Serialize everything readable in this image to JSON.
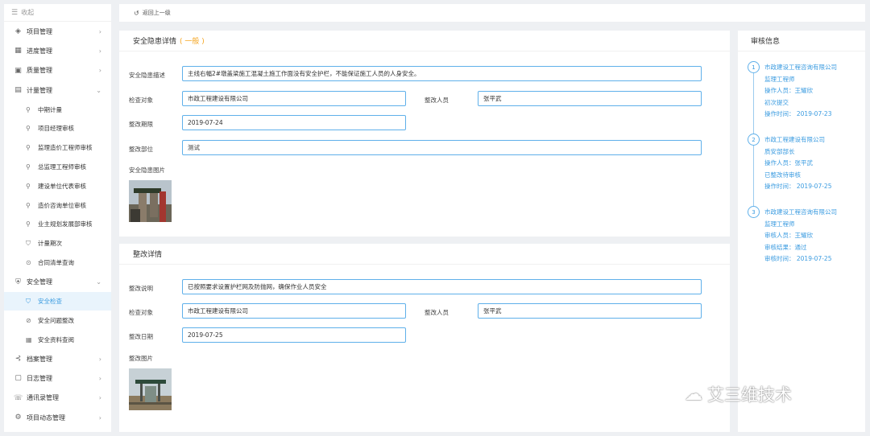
{
  "sidebar": {
    "collapse_label": "收起",
    "items": [
      {
        "label": "项目管理",
        "icon": "layers-icon",
        "glyph": "◈",
        "chevron": "›"
      },
      {
        "label": "进度管理",
        "icon": "grid-icon",
        "glyph": "▦",
        "chevron": "›"
      },
      {
        "label": "质量管理",
        "icon": "quality-icon",
        "glyph": "▣",
        "chevron": "›"
      },
      {
        "label": "计量管理",
        "icon": "document-icon",
        "glyph": "▤",
        "chevron": "⌄"
      }
    ],
    "measure_sub": [
      "中期计量",
      "项目经理审核",
      "监理造价工程师审核",
      "总监理工程师审核",
      "建设单位代表审核",
      "造价咨询单位审核",
      "业主规划发展部审核",
      "计量期次",
      "合同清单查询"
    ],
    "safety": {
      "label": "安全管理",
      "chevron": "⌄"
    },
    "safety_sub": [
      "安全检查",
      "安全问题整改",
      "安全资料查阅"
    ],
    "bottom_items": [
      {
        "label": "档案管理",
        "chevron": "›"
      },
      {
        "label": "日志管理",
        "chevron": "›"
      },
      {
        "label": "通讯录管理",
        "chevron": "›"
      },
      {
        "label": "项目动态管理",
        "chevron": "›"
      }
    ]
  },
  "topbar": {
    "back_label": "返回上一级"
  },
  "hazard": {
    "title": "安全隐患详情",
    "level": "( 一般 )",
    "desc_label": "安全隐患描述",
    "desc_value": "主线右幅2#墩盖梁施工混凝土施工作面没有安全护栏，不能保证施工人员的人身安全。",
    "target_label": "检查对象",
    "target_value": "市政工程建设有限公司",
    "person_label": "整改人员",
    "person_value": "张平武",
    "deadline_label": "整改期限",
    "deadline_value": "2019-07-24",
    "dept_label": "整改部位",
    "dept_value": "测试",
    "photo_label": "安全隐患图片"
  },
  "rectify": {
    "title": "整改详情",
    "desc_label": "整改说明",
    "desc_value": "已按照要求设置护栏网及防抛网，确保作业人员安全",
    "target_label": "检查对象",
    "target_value": "市政工程建设有限公司",
    "person_label": "整改人员",
    "person_value": "张平武",
    "date_label": "整改日期",
    "date_value": "2019-07-25",
    "photo_label": "整改图片"
  },
  "audit": {
    "title": "审核信息",
    "steps": [
      {
        "num": "1",
        "lines": [
          "市政建设工程咨询有限公司",
          "监理工程师",
          "操作人员：王耀欣",
          "初次提交",
          "操作时间： 2019-07-23"
        ]
      },
      {
        "num": "2",
        "lines": [
          "市政工程建设有限公司",
          "质安部部长",
          "操作人员：张平武",
          "已整改待审核",
          "操作时间： 2019-07-25"
        ]
      },
      {
        "num": "3",
        "lines": [
          "市政建设工程咨询有限公司",
          "监理工程师",
          "审核人员：王耀欣",
          "审核结果：通过",
          "审核时间： 2019-07-25"
        ]
      }
    ]
  },
  "watermark": {
    "text": "艾三维技术"
  },
  "colors": {
    "accent": "#3a9be0",
    "level": "#f5a623",
    "input_border": "#5fb0ea"
  }
}
